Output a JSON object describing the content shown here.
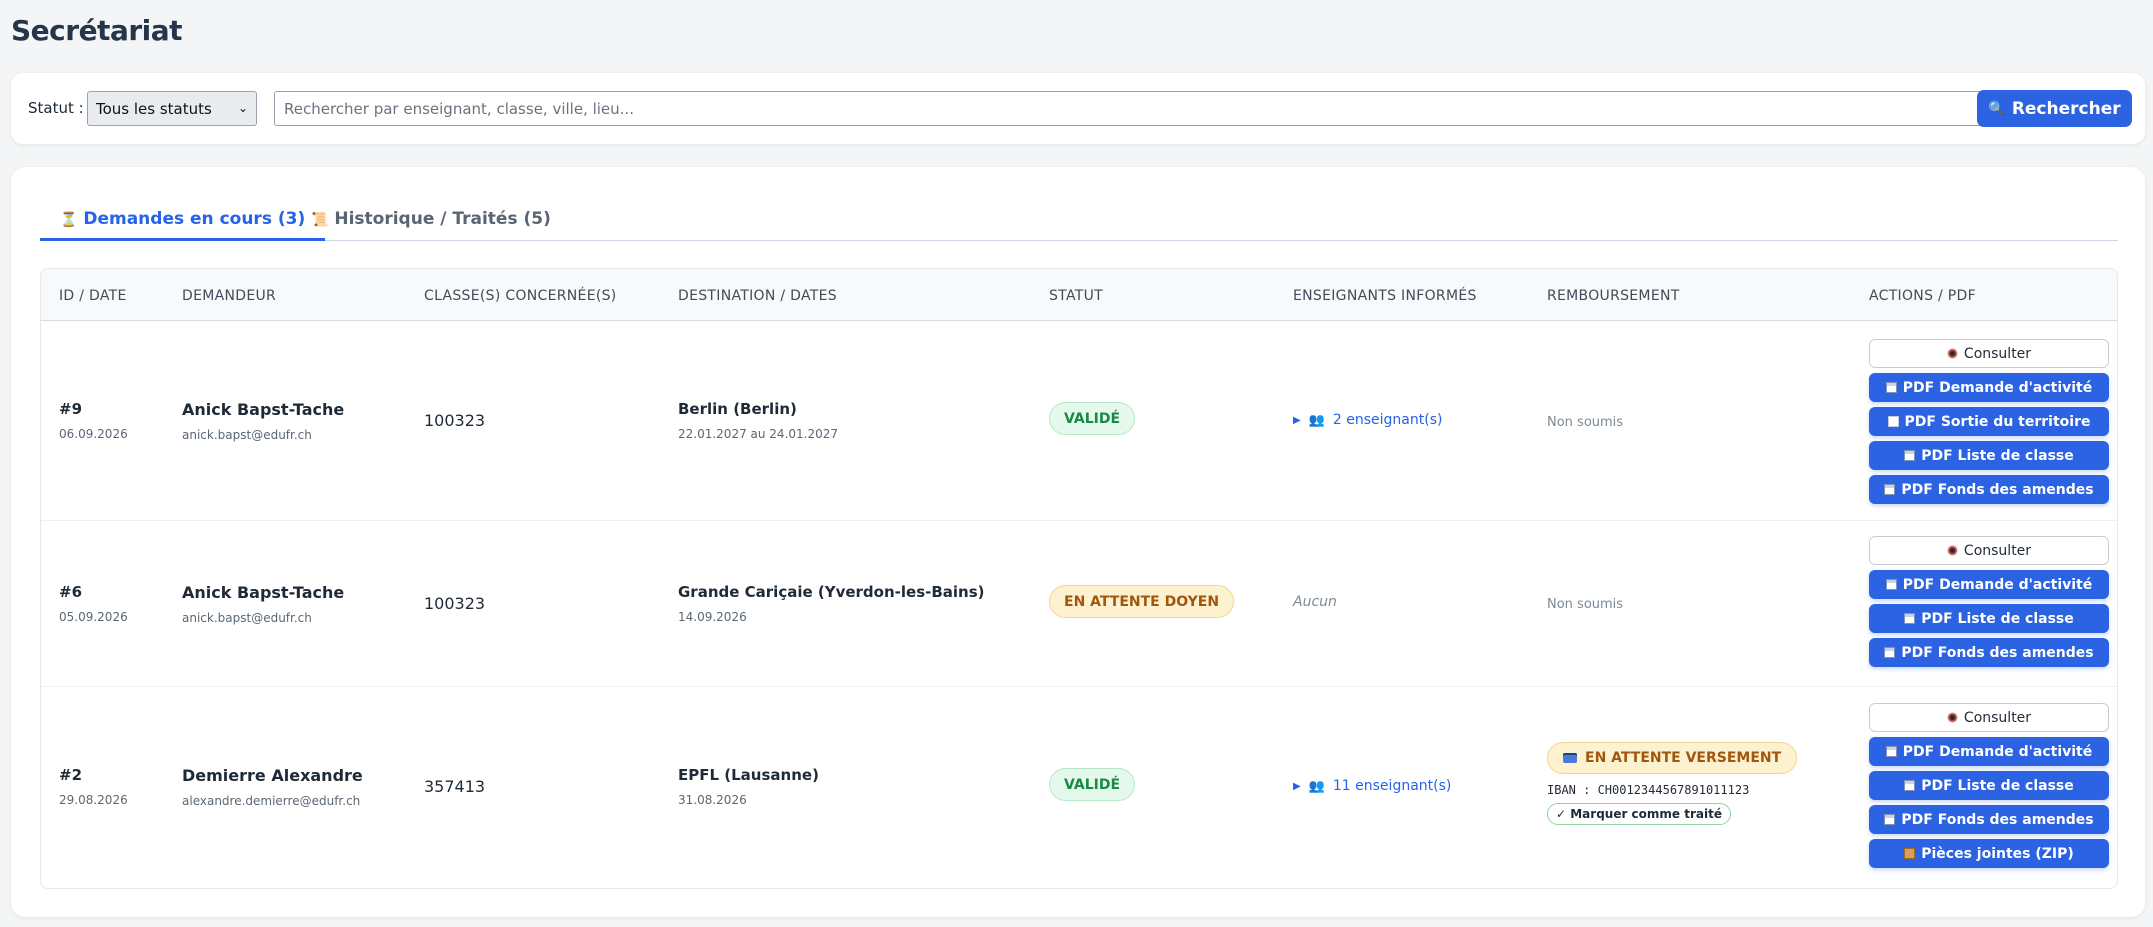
{
  "page": {
    "title": "Secrétariat"
  },
  "filter": {
    "status_label": "Statut :",
    "status_selected": "Tous les statuts",
    "search_placeholder": "Rechercher par enseignant, classe, ville, lieu...",
    "search_button": "Rechercher",
    "search_icon": "magnifier-icon"
  },
  "tabs": [
    {
      "icon": "hourglass-icon",
      "glyph": "⏳",
      "label": "Demandes en cours (3)",
      "active": true
    },
    {
      "icon": "scroll-icon",
      "glyph": "📜",
      "label": "Historique / Traités (5)",
      "active": false
    }
  ],
  "table": {
    "headers": [
      "ID / DATE",
      "DEMANDEUR",
      "CLASSE(S) CONCERNÉE(S)",
      "DESTINATION / DATES",
      "STATUT",
      "ENSEIGNANTS INFORMÉS",
      "REMBOURSEMENT",
      "ACTIONS / PDF"
    ],
    "rows": [
      {
        "id": "#9",
        "date": "06.09.2026",
        "name": "Anick Bapst-Tache",
        "email": "anick.bapst@edufr.ch",
        "class": "100323",
        "destination": "Berlin (Berlin)",
        "dates": "22.01.2027 au 24.01.2027",
        "status": "VALIDÉ",
        "teachers": "2 enseignant(s)",
        "reimbursement": "Non soumis",
        "actions": [
          "Consulter",
          "PDF Demande d'activité",
          "PDF Sortie du territoire",
          "PDF Liste de classe",
          "PDF Fonds des amendes"
        ]
      },
      {
        "id": "#6",
        "date": "05.09.2026",
        "name": "Anick Bapst-Tache",
        "email": "anick.bapst@edufr.ch",
        "class": "100323",
        "destination": "Grande Cariçaie (Yverdon-les-Bains)",
        "dates": "14.09.2026",
        "status": "EN ATTENTE DOYEN",
        "teachers": "Aucun",
        "reimbursement": "Non soumis",
        "actions": [
          "Consulter",
          "PDF Demande d'activité",
          "PDF Liste de classe",
          "PDF Fonds des amendes"
        ]
      },
      {
        "id": "#2",
        "date": "29.08.2026",
        "name": "Demierre Alexandre",
        "email": "alexandre.demierre@edufr.ch",
        "class": "357413",
        "destination": "EPFL (Lausanne)",
        "dates": "31.08.2026",
        "status": "VALIDÉ",
        "teachers": "11 enseignant(s)",
        "reimbursement_status": "EN ATTENTE VERSEMENT",
        "iban": "IBAN : CH0012344567891011123",
        "mark_done": "✓ Marquer comme traité",
        "actions": [
          "Consulter",
          "PDF Demande d'activité",
          "PDF Liste de classe",
          "PDF Fonds des amendes",
          "Pièces jointes (ZIP)"
        ]
      }
    ]
  },
  "colors": {
    "accent": "#2c63e2",
    "success": "#178a45",
    "warning": "#a2560d"
  }
}
